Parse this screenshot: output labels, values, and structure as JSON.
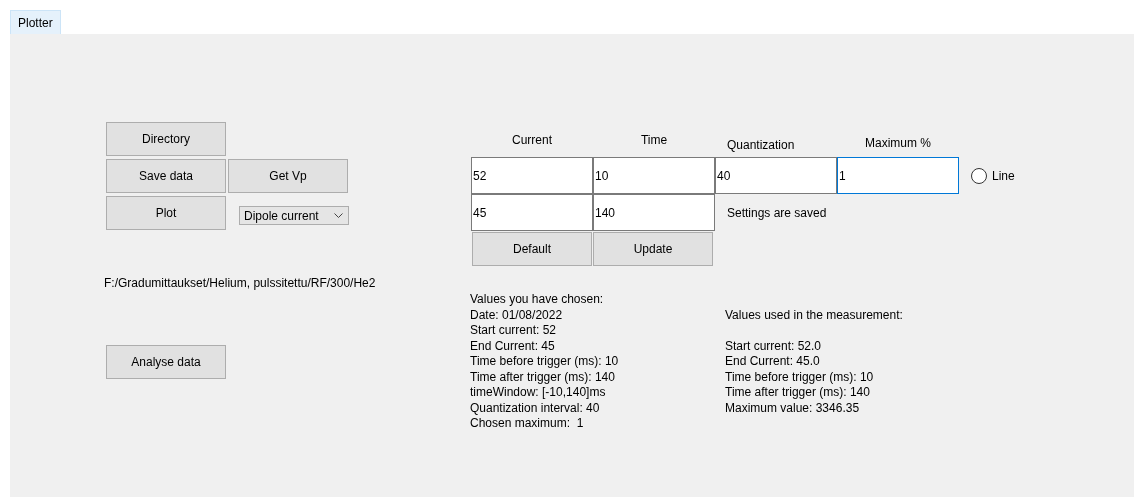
{
  "tabs": [
    {
      "label": "Plotter",
      "selected": true
    }
  ],
  "left_buttons": [
    {
      "label": "Directory"
    },
    {
      "label": "Save data"
    },
    {
      "label": "Get Vp"
    },
    {
      "label": "Plot"
    }
  ],
  "dropdown": {
    "value": "Dipole current"
  },
  "path": "F:/Gradumittaukset/Helium, pulssitettu/RF/300/He2",
  "analyse_button": "Analyse data",
  "columns": [
    "Current",
    "Time",
    "Quantization",
    "Maximum %"
  ],
  "inputs_row1": [
    {
      "value": "52",
      "focused": false
    },
    {
      "value": "10",
      "focused": false
    },
    {
      "value": "40",
      "focused": false
    },
    {
      "value": "1",
      "focused": true
    }
  ],
  "inputs_row2": [
    {
      "value": "45",
      "focused": false
    },
    {
      "value": "140",
      "focused": false
    }
  ],
  "line_radio": {
    "label": "Line",
    "selected": false
  },
  "status": "Settings are saved",
  "buttons": [
    "Default",
    "Update"
  ],
  "chosen_values": {
    "heading": "Values you have chosen:",
    "lines": [
      "Date: 01/08/2022",
      "Start current: 52",
      "End Current: 45",
      "Time before trigger (ms): 10",
      "Time after trigger (ms): 140",
      "timeWindow: [-10,140]ms",
      "Quantization interval: 40",
      "Chosen maximum:  1"
    ]
  },
  "measurement_values": {
    "heading": "Values used in the measurement:",
    "lines": [
      "Start current: 52.0",
      "End Current: 45.0",
      "Time before trigger (ms): 10",
      "Time after trigger (ms): 140",
      "Maximum value: 3346.35"
    ]
  }
}
